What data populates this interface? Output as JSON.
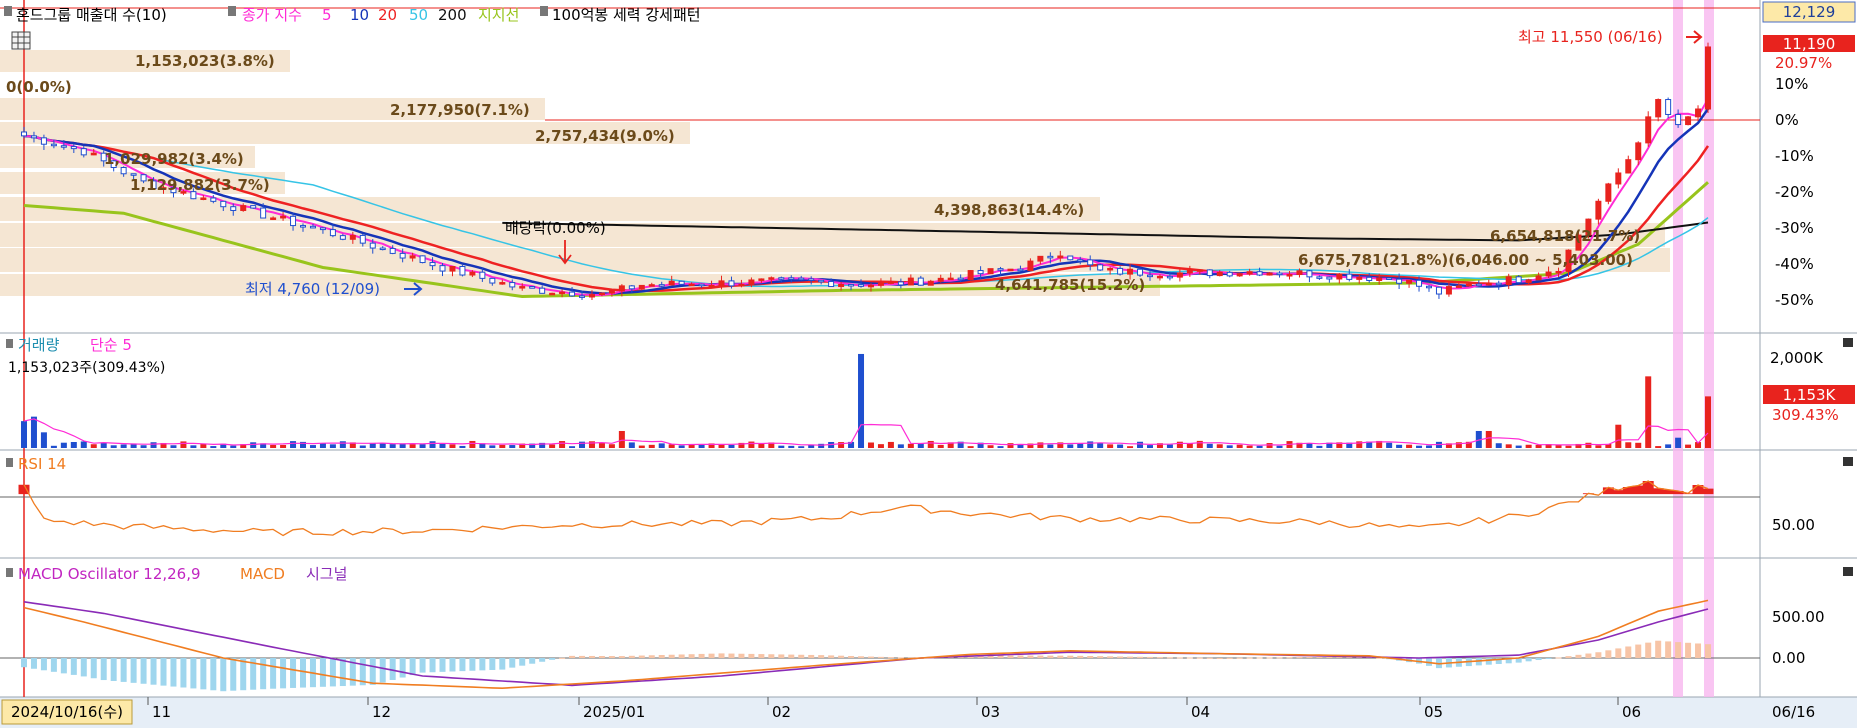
{
  "colors": {
    "up": "#e8231e",
    "down": "#1f4fcf",
    "ma5": "#ff2bd6",
    "ma10": "#1534b8",
    "ma20": "#ee2222",
    "ma50": "#36c4e6",
    "ma200": "#111111",
    "resistance": "#98c41c",
    "band": "#f5e6d3",
    "rsi": "#f07d21",
    "macd": "#f07d21",
    "signal": "#8a2bb7",
    "osc_pos": "#f7c4a6",
    "osc_neg": "#9fd6ee",
    "highlight": "#f7b6ef",
    "axis_bg": "#e6eef7"
  },
  "header": {
    "icon": "grid-icon",
    "title": "혼드그룹 매출대 수(10)",
    "ma_label": "종가 지수",
    "ma_5": "5",
    "ma_10": "10",
    "ma_20": "20",
    "ma_50": "50",
    "ma_200": "200",
    "resistance_label": "지지선",
    "pattern_label": "100억봉 세력 강세패턴"
  },
  "price_panel": {
    "current_box": "12,129",
    "last_price": "11,190",
    "last_pct": "20.97%",
    "high_label": "최고 11,550 (06/16)",
    "low_label": "최저 4,760 (12/09)",
    "dividend_label": "배당락(0.00%)",
    "volume_profile": [
      {
        "text": "1,153,023(3.8%)"
      },
      {
        "text": "0(0.0%)"
      },
      {
        "text": "2,177,950(7.1%)"
      },
      {
        "text": "2,757,434(9.0%)"
      },
      {
        "text": "1,029,982(3.4%)"
      },
      {
        "text": "1,129,882(3.7%)"
      },
      {
        "text": "4,398,863(14.4%)"
      },
      {
        "text": "6,654,818(21.7%)"
      },
      {
        "text": "6,675,781(21.8%)(6,046.00 ~ 5,403.00)"
      },
      {
        "text": "4,641,785(15.2%)"
      }
    ],
    "y_ticks": [
      "10%",
      "0%",
      "-10%",
      "-20%",
      "-30%",
      "-40%",
      "-50%"
    ]
  },
  "volume_panel": {
    "title": "거래량",
    "ma_label": "단순 5",
    "last_text": "1,153,023주(309.43%)",
    "last_box": "1,153K",
    "last_pct": "309.43%",
    "y_tick": "2,000K"
  },
  "rsi_panel": {
    "title": "RSI 14",
    "y_tick": "50.00"
  },
  "macd_panel": {
    "title": "MACD Oscillator 12,26,9",
    "macd_label": "MACD",
    "signal_label": "시그널",
    "y_ticks": [
      "500.00",
      "0.00"
    ]
  },
  "x_axis": {
    "start_label": "2024/10/16(수)",
    "ticks": [
      "11",
      "12",
      "2025/01",
      "02",
      "03",
      "04",
      "05",
      "06"
    ],
    "end_label": "06/16"
  },
  "chart_data": [
    {
      "type": "line",
      "title": "혼드그룹",
      "x": [
        "2024/10/16",
        "2024/11",
        "2024/12",
        "2025/01",
        "2025/02",
        "2025/03",
        "2025/04",
        "2025/05",
        "2025/06",
        "06/16"
      ],
      "series": [
        {
          "name": "종가",
          "values": [
            9000,
            7200,
            4950,
            5200,
            5500,
            5450,
            5100,
            6500,
            9300,
            11190
          ]
        },
        {
          "name": "5",
          "values": [
            9100,
            7300,
            5000,
            5150,
            5450,
            5400,
            5150,
            6400,
            9000,
            10300
          ]
        },
        {
          "name": "20",
          "values": [
            9300,
            7600,
            5200,
            5100,
            5400,
            5400,
            5200,
            6100,
            8500,
            9500
          ]
        },
        {
          "name": "200",
          "values": [
            null,
            null,
            6700,
            6500,
            6300,
            6200,
            6100,
            6150,
            6500,
            6750
          ]
        },
        {
          "name": "지지선",
          "values": [
            7200,
            6900,
            4850,
            4950,
            5050,
            5150,
            5200,
            5400,
            6600,
            7800
          ]
        }
      ],
      "y_ticks_pct": [
        10,
        0,
        -10,
        -20,
        -30,
        -40,
        -50
      ],
      "high": {
        "value": 11550,
        "date": "06/16"
      },
      "low": {
        "value": 4760,
        "date": "12/09"
      }
    },
    {
      "type": "bar",
      "title": "거래량",
      "ylim": [
        0,
        2300000
      ],
      "last_value": 1153023,
      "peak_value": 2100000
    },
    {
      "type": "area",
      "title": "RSI 14",
      "ylim": [
        0,
        100
      ],
      "ref_line": 70,
      "y_tick": 50
    },
    {
      "type": "line",
      "title": "MACD Oscillator 12,26,9",
      "y_ticks": [
        500,
        0
      ]
    }
  ]
}
